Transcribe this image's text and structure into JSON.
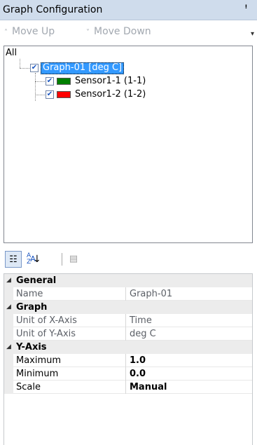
{
  "panel": {
    "title": "Graph Configuration",
    "pin_icon": "pin-icon"
  },
  "toolbar": {
    "move_up": "Move Up",
    "move_down": "Move Down"
  },
  "tree": {
    "root": "All",
    "graph": {
      "label": "Graph-01 [deg C]",
      "checked": true
    },
    "sensors": [
      {
        "label": "Sensor1-1 (1-1)",
        "color": "#008000",
        "checked": true
      },
      {
        "label": "Sensor1-2 (1-2)",
        "color": "#ff0000",
        "checked": true
      }
    ]
  },
  "property_grid": {
    "categories": [
      {
        "name": "General",
        "props": [
          {
            "name": "Name",
            "value": "Graph-01"
          }
        ]
      },
      {
        "name": "Graph",
        "props": [
          {
            "name": "Unit of X-Axis",
            "value": "Time"
          },
          {
            "name": "Unit of Y-Axis",
            "value": "deg C"
          }
        ]
      },
      {
        "name": "Y-Axis",
        "props": [
          {
            "name": "Maximum",
            "value": "1.0"
          },
          {
            "name": "Minimum",
            "value": "0.0"
          },
          {
            "name": "Scale",
            "value": "Manual"
          }
        ]
      }
    ]
  },
  "colors": {
    "selection": "#3399ff",
    "title_bg": "#cfdcec"
  }
}
